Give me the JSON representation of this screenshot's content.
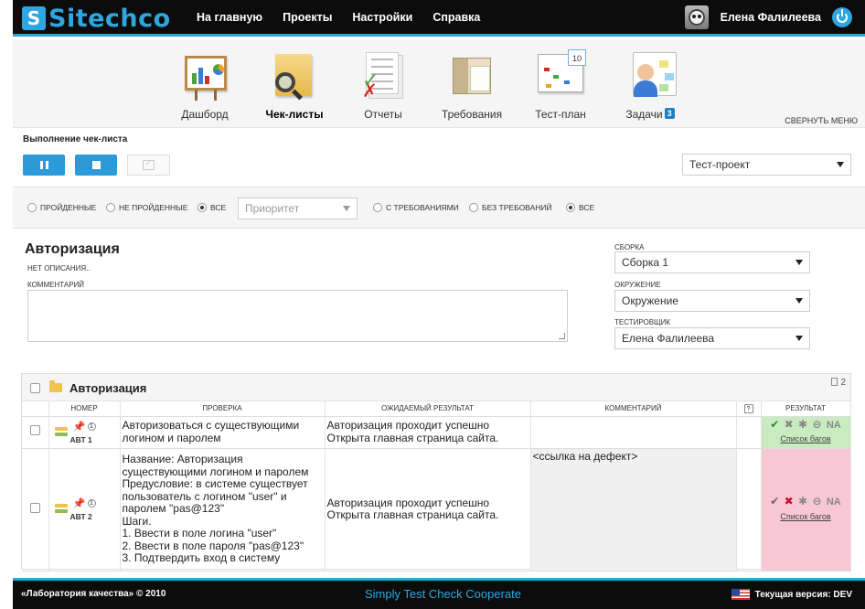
{
  "header": {
    "logo_letter": "S",
    "logo_text": "Sitechco",
    "nav": [
      "На главную",
      "Проекты",
      "Настройки",
      "Справка"
    ],
    "user_name": "Елена Фалилеева"
  },
  "modules": {
    "items": [
      {
        "label": "Дашборд",
        "icon": "dashboard-board-icon"
      },
      {
        "label": "Чек-листы",
        "icon": "checklist-folder-magnifier-icon",
        "active": true
      },
      {
        "label": "Отчеты",
        "icon": "reports-docs-icon"
      },
      {
        "label": "Требования",
        "icon": "requirements-books-icon"
      },
      {
        "label": "Тест-план",
        "icon": "test-plan-calendar-icon",
        "calendar_day": "10"
      },
      {
        "label": "Задачи",
        "icon": "tasks-person-icon",
        "badge": "3"
      }
    ],
    "collapse_label": "СВЕРНУТЬ МЕНЮ"
  },
  "run": {
    "title": "Выполнение чек-листа",
    "project_select": "Тест-проект"
  },
  "filters": {
    "status_options": [
      "ПРОЙДЕННЫЕ",
      "НЕ ПРОЙДЕННЫЕ",
      "ВСЕ"
    ],
    "status_selected": "ВСЕ",
    "priority_placeholder": "Приоритет",
    "req_options": [
      "С ТРЕБОВАНИЯМИ",
      "БЕЗ ТРЕБОВАНИЙ",
      "ВСЕ"
    ],
    "req_selected": "ВСЕ"
  },
  "detail": {
    "title": "Авторизация",
    "no_description": "НЕТ ОПИСАНИЯ..",
    "comment_label": "КОММЕНТАРИЙ",
    "build_label": "СБОРКА",
    "build_value": "Сборка 1",
    "env_label": "ОКРУЖЕНИЕ",
    "env_value": "Окружение",
    "tester_label": "ТЕСТИРОВЩИК",
    "tester_value": "Елена Фалилеева"
  },
  "table": {
    "group_title": "Авторизация",
    "count": "2",
    "columns": {
      "number": "НОМЕР",
      "check": "ПРОВЕРКА",
      "expected": "ОЖИДАЕМЫЙ РЕЗУЛЬТАТ",
      "comment": "КОММЕНТАРИЙ",
      "help": "?",
      "result": "РЕЗУЛЬТАТ"
    },
    "rows": [
      {
        "id": "АВТ 1",
        "badge": "1",
        "check": [
          "Авторизоваться с существующими",
          "логином и паролем"
        ],
        "expected": [
          "Авторизация проходит успешно",
          "Открыта главная страница сайта."
        ],
        "comment": "",
        "status": "pass",
        "na": "NA",
        "bugs_link": "Список багов"
      },
      {
        "id": "АВТ 2",
        "badge": "1",
        "check": [
          "Название: Авторизация",
          "существующими логином и паролем",
          "Предусловие: в системе существует",
          "пользователь с логином \"user\" и",
          "паролем \"pas@123\"",
          "Шаги.",
          "1. Ввести в поле логина \"user\"",
          "2. Ввести в поле пароля \"pas@123\"",
          "3. Подтвердить вход в систему"
        ],
        "expected": [
          "Авторизация проходит успешно",
          "Открыта главная страница сайта."
        ],
        "comment": "<ссылка на дефект>",
        "status": "fail",
        "na": "NA",
        "bugs_link": "Список багов"
      }
    ]
  },
  "footer": {
    "copyright": "«Лаборатория качества» © 2010",
    "slogan": "Simply Test Check Cooperate",
    "version": "Текущая версия: DEV"
  },
  "colors": {
    "accent": "#2fa6df",
    "pass": "#c8ecbf",
    "fail": "#f8c7d4",
    "dark": "#0c0c0c"
  }
}
